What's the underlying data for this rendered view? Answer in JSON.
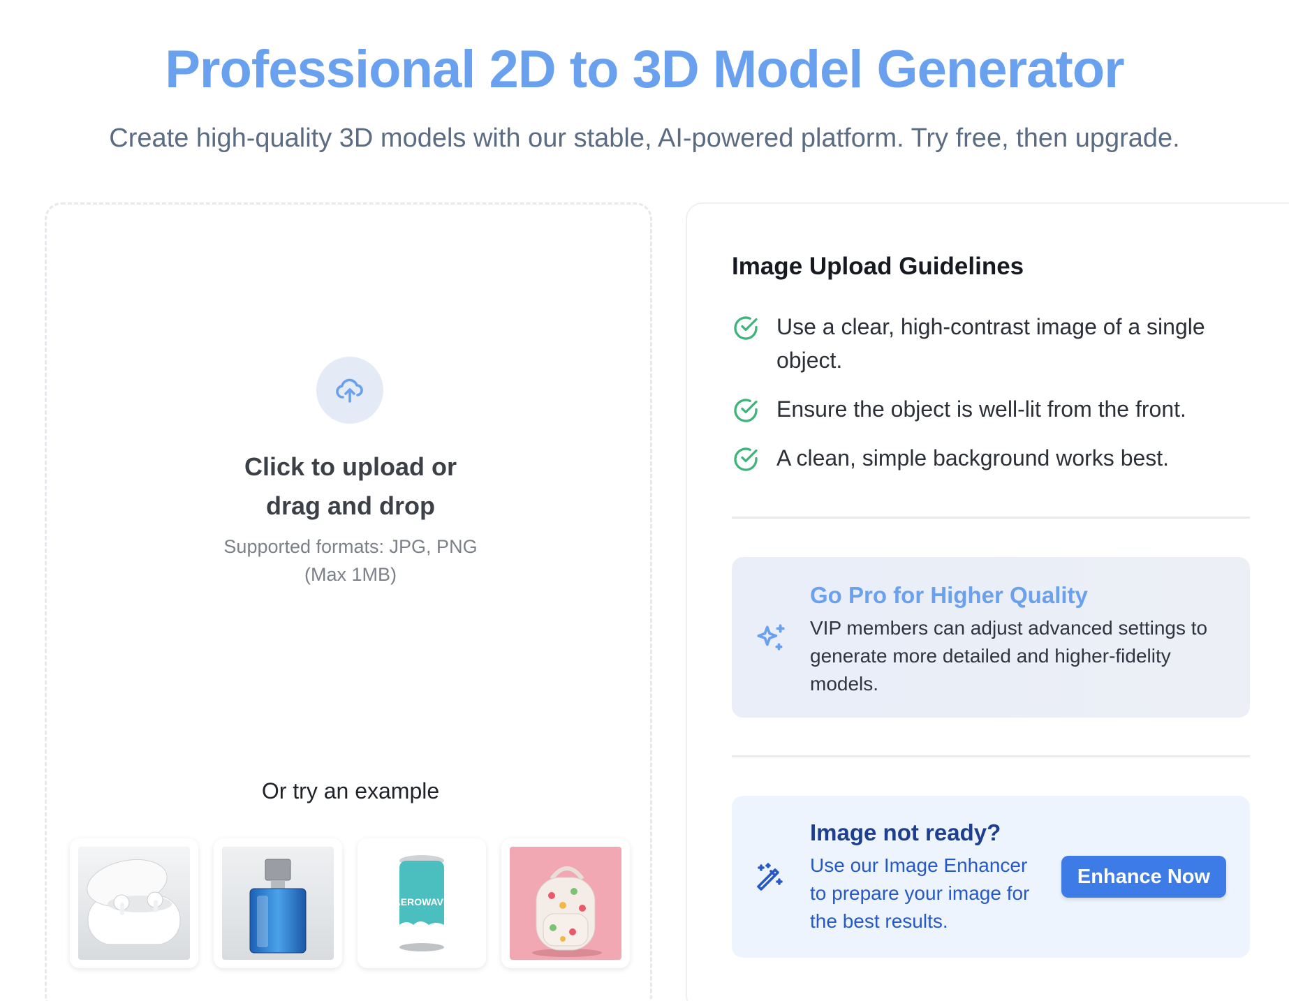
{
  "header": {
    "title": "Professional 2D to 3D Model Generator",
    "subtitle": "Create high-quality 3D models with our stable, AI-powered platform. Try free, then upgrade."
  },
  "upload": {
    "title": "Click to upload or drag and drop",
    "formats": "Supported formats: JPG, PNG (Max 1MB)",
    "examples_title": "Or try an example",
    "examples": [
      "earbuds",
      "perfume-bottle",
      "soda-can",
      "backpack"
    ],
    "can_label": "AEROWAVE"
  },
  "guidelines": {
    "title": "Image Upload Guidelines",
    "items": [
      "Use a clear, high-contrast image of a single object.",
      "Ensure the object is well-lit from the front.",
      "A clean, simple background works best."
    ]
  },
  "pro": {
    "title": "Go Pro for Higher Quality",
    "text": "VIP members can adjust advanced settings to generate more detailed and higher-fidelity models."
  },
  "enhancer": {
    "title": "Image not ready?",
    "text": "Use our Image Enhancer to prepare your image for the best results.",
    "button": "Enhance Now"
  },
  "colors": {
    "accent": "#6aa1ef",
    "button": "#3d7be6",
    "check": "#3fb47a"
  }
}
